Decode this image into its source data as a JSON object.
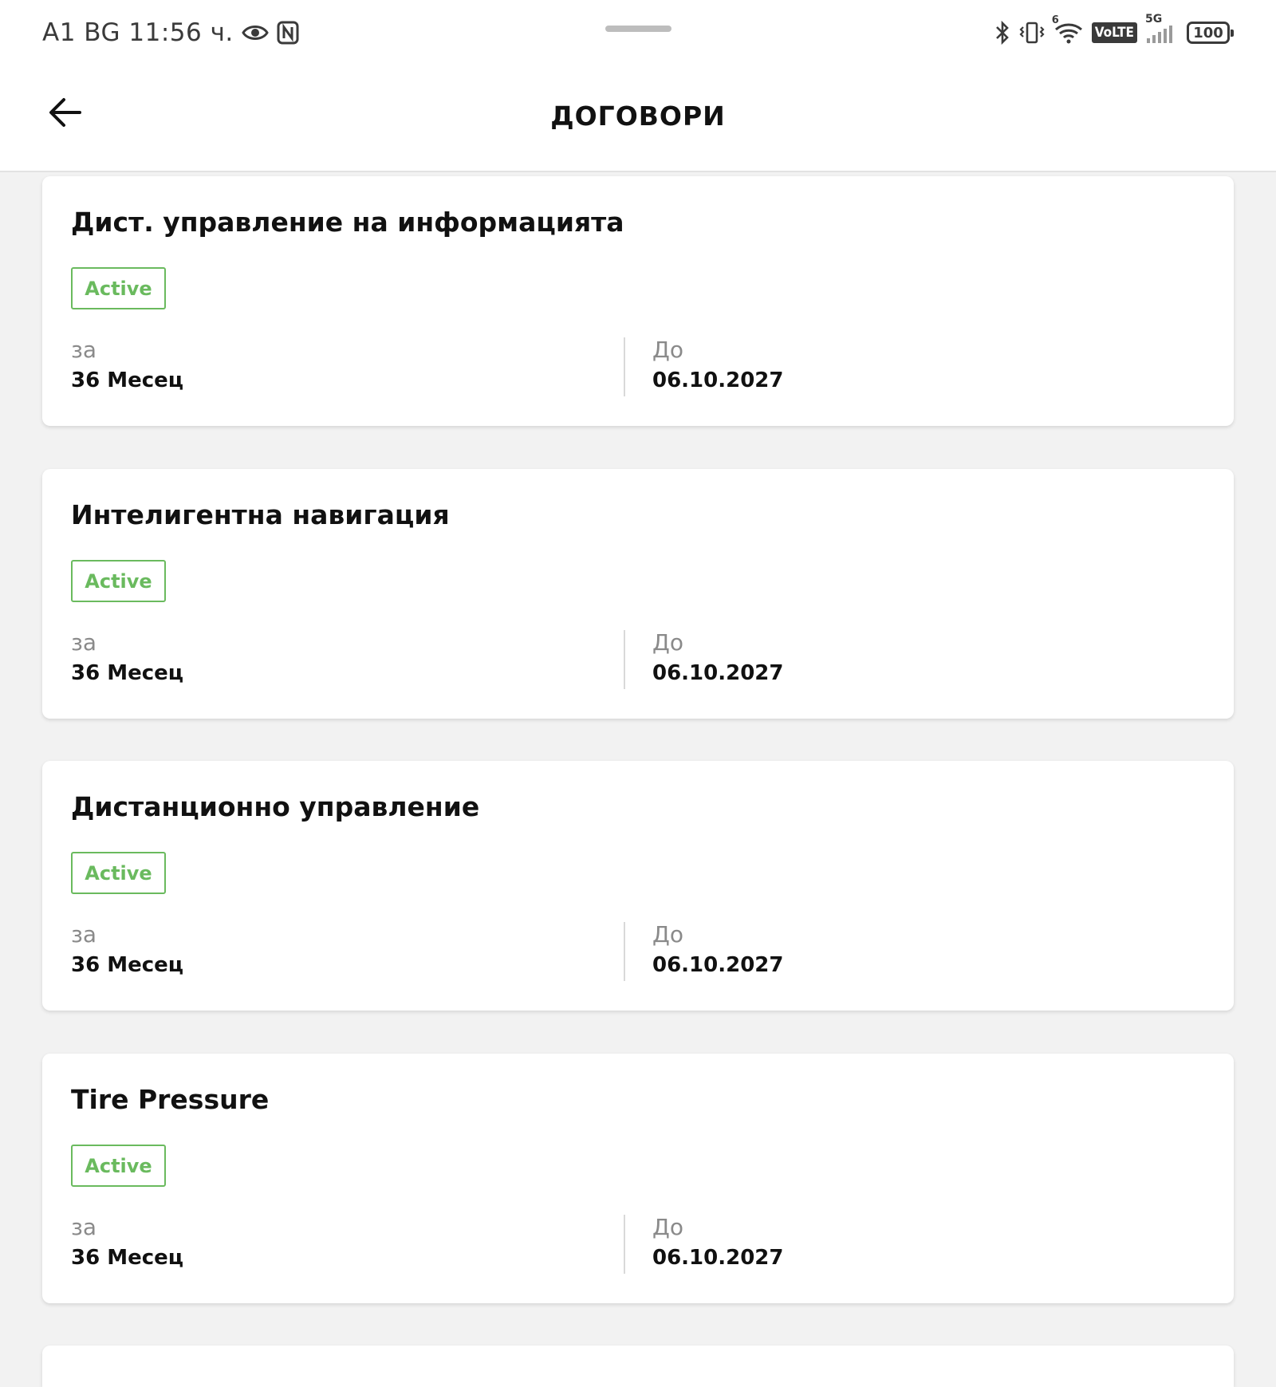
{
  "status_bar": {
    "carrier_time": "A1 BG 11:56 ч.",
    "network_type": "5G",
    "volte": "VoLTE",
    "wifi_badge": "6",
    "battery": "100",
    "icons": [
      "eye-icon",
      "nfc-icon",
      "bluetooth-icon",
      "vibrate-icon",
      "wifi-icon",
      "volte-icon",
      "signal-icon",
      "battery-icon"
    ]
  },
  "header": {
    "title": "ДОГОВОРИ",
    "back_icon": "arrow-left-icon"
  },
  "colors": {
    "accent_green": "#6aba5e",
    "background": "#f2f2f2",
    "card": "#ffffff"
  },
  "contracts": [
    {
      "title": "Дист. управление на информацията",
      "status": "Active",
      "for_label": "за",
      "for_value": "36 Месец",
      "until_label": "До",
      "until_value": "06.10.2027"
    },
    {
      "title": "Интелигентна навигация",
      "status": "Active",
      "for_label": "за",
      "for_value": "36 Месец",
      "until_label": "До",
      "until_value": "06.10.2027"
    },
    {
      "title": "Дистанционно управление",
      "status": "Active",
      "for_label": "за",
      "for_value": "36 Месец",
      "until_label": "До",
      "until_value": "06.10.2027"
    },
    {
      "title": "Tire Pressure",
      "status": "Active",
      "for_label": "за",
      "for_value": "36 Месец",
      "until_label": "До",
      "until_value": "06.10.2027"
    }
  ]
}
